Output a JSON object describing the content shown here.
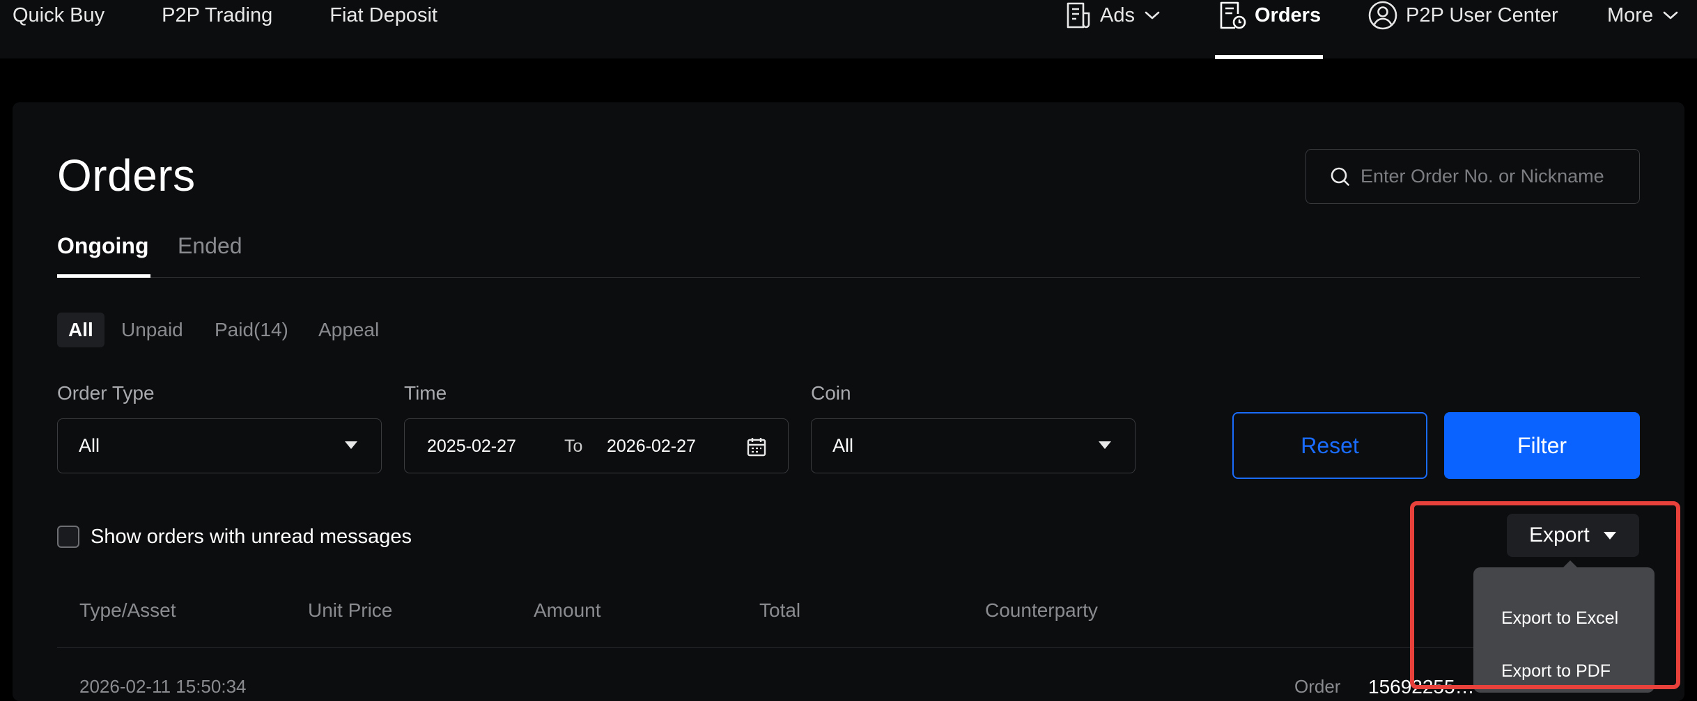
{
  "nav": {
    "left_links": [
      "Quick Buy",
      "P2P Trading",
      "Fiat Deposit"
    ],
    "ads": "Ads",
    "orders": "Orders",
    "user_center": "P2P User Center",
    "more": "More"
  },
  "page": {
    "title": "Orders",
    "search_placeholder": "Enter Order No. or Nickname"
  },
  "tabs": [
    {
      "label": "Ongoing",
      "active": true
    },
    {
      "label": "Ended",
      "active": false
    }
  ],
  "subtabs": [
    {
      "label": "All",
      "active": true
    },
    {
      "label": "Unpaid",
      "active": false
    },
    {
      "label": "Paid(14)",
      "active": false
    },
    {
      "label": "Appeal",
      "active": false
    }
  ],
  "filters": {
    "order_type": {
      "label": "Order Type",
      "value": "All"
    },
    "time": {
      "label": "Time",
      "from": "2025-02-27",
      "to_label": "To",
      "to": "2026-02-27"
    },
    "coin": {
      "label": "Coin",
      "value": "All"
    },
    "reset_label": "Reset",
    "filter_label": "Filter"
  },
  "unread_checkbox": {
    "label": "Show orders with unread messages",
    "checked": false
  },
  "export": {
    "label": "Export",
    "menu": [
      "Export to Excel",
      "Export to PDF"
    ]
  },
  "table": {
    "columns": [
      "Type/Asset",
      "Unit Price",
      "Amount",
      "Total",
      "Counterparty"
    ],
    "first_row_peek": {
      "datetime": "2026-02-11 15:50:34",
      "order_label": "Order",
      "order_no": "15692255…"
    }
  },
  "colors": {
    "accent": "#0b63ff",
    "highlight": "#e8413b",
    "background": "#000000",
    "card": "#0c0d0f"
  }
}
